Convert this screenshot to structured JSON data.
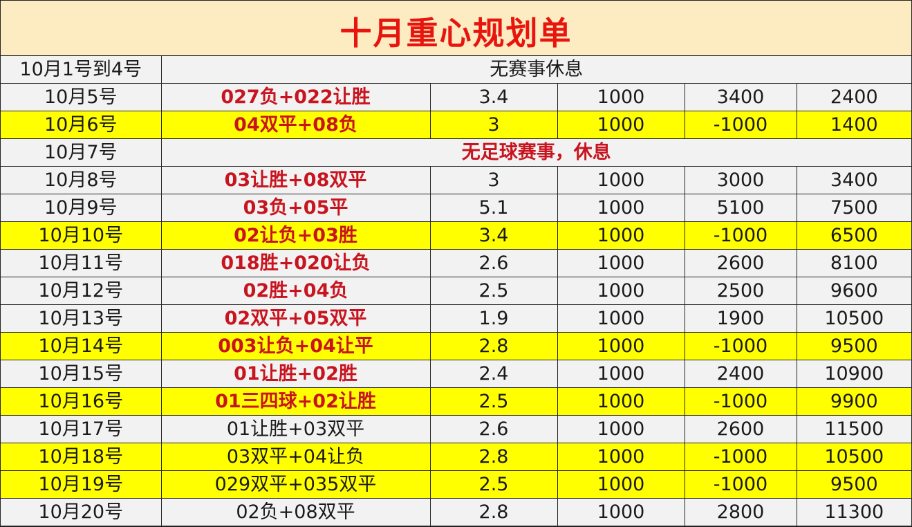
{
  "title": "十月重心规划单",
  "colors": {
    "title_bg": "#fdebc2",
    "title_text": "#e8140e",
    "highlight": "#ffff00",
    "pick_text": "#c8141e",
    "row_bg": "#f2f2f2"
  },
  "rows": [
    {
      "date": "10月1号到4号",
      "merged": true,
      "note": "无赛事休息",
      "note_bold": false,
      "yellow": false
    },
    {
      "date": "10月5号",
      "pick": "027负+022让胜",
      "pick_bold": true,
      "odds": "3.4",
      "stake": "1000",
      "result": "3400",
      "total": "2400",
      "yellow": false
    },
    {
      "date": "10月6号",
      "pick": "04双平+08负",
      "pick_bold": true,
      "odds": "3",
      "stake": "1000",
      "result": "-1000",
      "total": "1400",
      "yellow": true
    },
    {
      "date": "10月7号",
      "merged": true,
      "note": "无足球赛事，休息",
      "note_bold": true,
      "yellow": false
    },
    {
      "date": "10月8号",
      "pick": "03让胜+08双平",
      "pick_bold": true,
      "odds": "3",
      "stake": "1000",
      "result": "3000",
      "total": "3400",
      "yellow": false
    },
    {
      "date": "10月9号",
      "pick": "03负+05平",
      "pick_bold": true,
      "odds": "5.1",
      "stake": "1000",
      "result": "5100",
      "total": "7500",
      "yellow": false
    },
    {
      "date": "10月10号",
      "pick": "02让负+03胜",
      "pick_bold": true,
      "odds": "3.4",
      "stake": "1000",
      "result": "-1000",
      "total": "6500",
      "yellow": true
    },
    {
      "date": "10月11号",
      "pick": "018胜+020让负",
      "pick_bold": true,
      "odds": "2.6",
      "stake": "1000",
      "result": "2600",
      "total": "8100",
      "yellow": false
    },
    {
      "date": "10月12号",
      "pick": "02胜+04负",
      "pick_bold": true,
      "odds": "2.5",
      "stake": "1000",
      "result": "2500",
      "total": "9600",
      "yellow": false
    },
    {
      "date": "10月13号",
      "pick": "02双平+05双平",
      "pick_bold": true,
      "odds": "1.9",
      "stake": "1000",
      "result": "1900",
      "total": "10500",
      "yellow": false
    },
    {
      "date": "10月14号",
      "pick": "003让负+04让平",
      "pick_bold": true,
      "odds": "2.8",
      "stake": "1000",
      "result": "-1000",
      "total": "9500",
      "yellow": true
    },
    {
      "date": "10月15号",
      "pick": "01让胜+02胜",
      "pick_bold": true,
      "odds": "2.4",
      "stake": "1000",
      "result": "2400",
      "total": "10900",
      "yellow": false
    },
    {
      "date": "10月16号",
      "pick": "01三四球+02让胜",
      "pick_bold": true,
      "odds": "2.5",
      "stake": "1000",
      "result": "-1000",
      "total": "9900",
      "yellow": true
    },
    {
      "date": "10月17号",
      "pick": "01让胜+03双平",
      "pick_bold": false,
      "odds": "2.6",
      "stake": "1000",
      "result": "2600",
      "total": "11500",
      "yellow": false
    },
    {
      "date": "10月18号",
      "pick": "03双平+04让负",
      "pick_bold": false,
      "odds": "2.8",
      "stake": "1000",
      "result": "-1000",
      "total": "10500",
      "yellow": true
    },
    {
      "date": "10月19号",
      "pick": "029双平+035双平",
      "pick_bold": false,
      "odds": "2.5",
      "stake": "1000",
      "result": "-1000",
      "total": "9500",
      "yellow": true
    },
    {
      "date": "10月20号",
      "pick": "02负+08双平",
      "pick_bold": false,
      "odds": "2.8",
      "stake": "1000",
      "result": "2800",
      "total": "11300",
      "yellow": false
    }
  ]
}
